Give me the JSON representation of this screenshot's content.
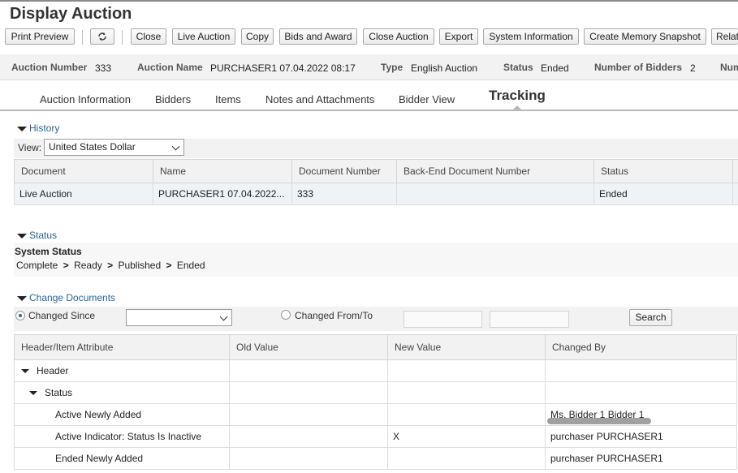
{
  "page_title": "Display Auction",
  "toolbar": {
    "print_preview": "Print Preview",
    "refresh_icon": "refresh-icon",
    "close": "Close",
    "live_auction": "Live Auction",
    "copy": "Copy",
    "bids_and_award": "Bids and Award",
    "close_auction": "Close Auction",
    "export": "Export",
    "system_information": "System Information",
    "create_memory_snapshot": "Create Memory Snapshot",
    "related": "Relat"
  },
  "header": {
    "auction_number_label": "Auction Number",
    "auction_number": "333",
    "auction_name_label": "Auction Name",
    "auction_name": "PURCHASER1 07.04.2022 08:17",
    "type_label": "Type",
    "type": "English Auction",
    "status_label": "Status",
    "status": "Ended",
    "bidders_label": "Number of Bidders",
    "bidders": "2",
    "num_label": "Num"
  },
  "tabs": {
    "auction_information": "Auction Information",
    "bidders": "Bidders",
    "items": "Items",
    "notes": "Notes and Attachments",
    "bidder_view": "Bidder View",
    "tracking": "Tracking"
  },
  "history": {
    "title": "History",
    "view_label": "View:",
    "view_value": "United States Dollar",
    "columns": [
      "Document",
      "Name",
      "Document Number",
      "Back-End Document Number",
      "Status"
    ],
    "row": {
      "document": "Live Auction",
      "name": "PURCHASER1 07.04.2022...",
      "document_number": "333",
      "backend_number": "",
      "status": "Ended"
    }
  },
  "status_section": {
    "title": "Status",
    "system_status_label": "System Status",
    "path": [
      "Complete",
      "Ready",
      "Published",
      "Ended"
    ],
    "arrow": ">"
  },
  "change_documents": {
    "title": "Change Documents",
    "changed_since_label": "Changed Since",
    "changed_from_to_label": "Changed From/To",
    "search_label": "Search",
    "columns": [
      "Header/Item Attribute",
      "Old Value",
      "New Value",
      "Changed By"
    ],
    "rows": [
      {
        "attribute": "Header",
        "old": "",
        "new": "",
        "by": ""
      },
      {
        "attribute": "Status",
        "old": "",
        "new": "",
        "by": ""
      },
      {
        "attribute": "Active Newly Added",
        "old": "",
        "new": "",
        "by": "Ms. Bidder 1 Bidder 1"
      },
      {
        "attribute": "Active Indicator: Status Is Inactive",
        "old": "",
        "new": "X",
        "by": "purchaser PURCHASER1"
      },
      {
        "attribute": "Ended Newly Added",
        "old": "",
        "new": "",
        "by": "purchaser PURCHASER1"
      }
    ]
  }
}
